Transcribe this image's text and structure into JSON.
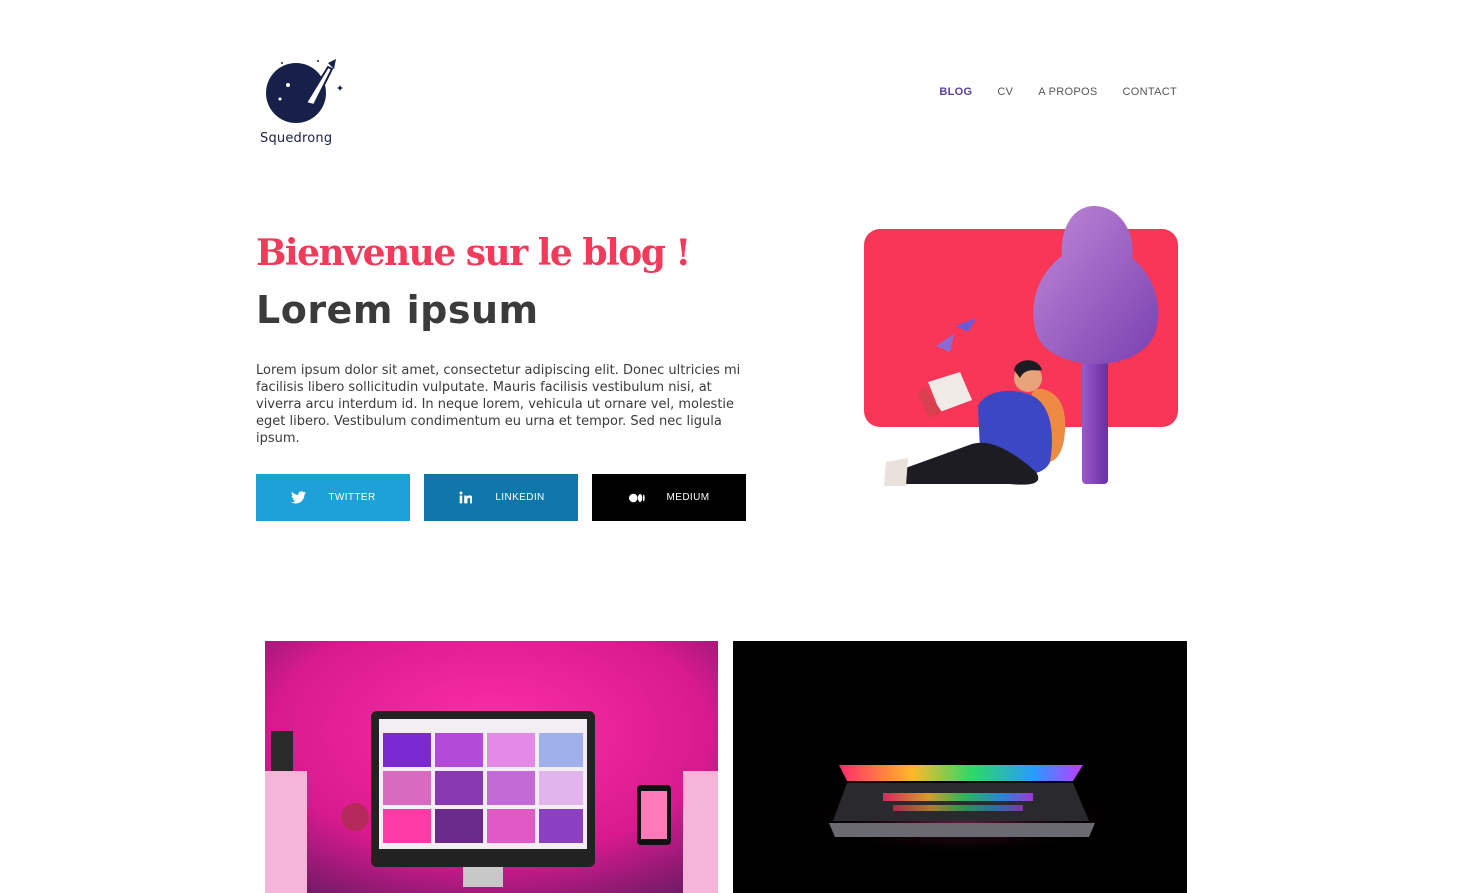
{
  "brand": {
    "name": "Squedrong"
  },
  "nav": {
    "items": [
      {
        "label": "BLOG",
        "active": true
      },
      {
        "label": "CV",
        "active": false
      },
      {
        "label": "A PROPOS",
        "active": false
      },
      {
        "label": "CONTACT",
        "active": false
      }
    ]
  },
  "hero": {
    "title": "Bienvenue sur le blog !",
    "subtitle": "Lorem ipsum",
    "text": "Lorem ipsum dolor sit amet, consectetur adipiscing elit. Donec ultricies mi facilisis libero sollicitudin vulputate. Mauris facilisis vestibulum nisi, at viverra arcu interdum id. In neque lorem, vehicula ut ornare vel, molestie eget libero. Vestibulum condimentum eu urna et tempor. Sed nec ligula ipsum."
  },
  "social": {
    "twitter": {
      "label": "TWITTER",
      "icon": "twitter-icon",
      "color": "#1da1d6"
    },
    "linkedin": {
      "label": "LINKEDIN",
      "icon": "linkedin-icon",
      "color": "#0e76a8"
    },
    "medium": {
      "label": "MEDIUM",
      "icon": "medium-icon",
      "color": "#000000"
    }
  },
  "colors": {
    "accent": "#f23a5b",
    "nav_active": "#5a3f9c"
  }
}
